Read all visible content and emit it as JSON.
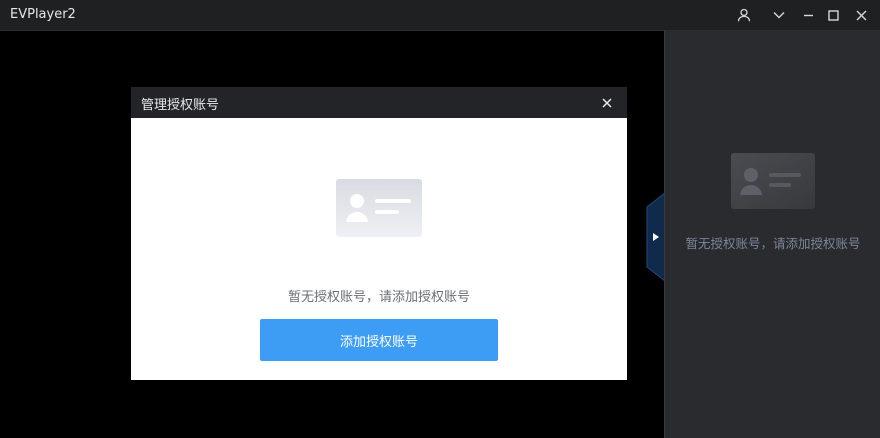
{
  "window": {
    "title": "EVPlayer2",
    "controls": [
      "user-icon",
      "chevron-down-icon",
      "minimize-icon",
      "maximize-icon",
      "close-icon"
    ]
  },
  "side_panel": {
    "empty_text": "暂无授权账号，请添加授权账号",
    "icon": "id-card-icon",
    "handle_icon": "play-triangle-icon"
  },
  "modal": {
    "title": "管理授权账号",
    "close_icon": "close-icon",
    "illustration": "id-card-icon",
    "empty_message": "暂无授权账号，请添加授权账号",
    "add_button_label": "添加授权账号"
  },
  "colors": {
    "titlebar": "#1f2022",
    "modal_header": "#232427",
    "side_panel": "#2a2b2e",
    "accent_button": "#3d9df5",
    "handle": "#0f2a4a"
  }
}
